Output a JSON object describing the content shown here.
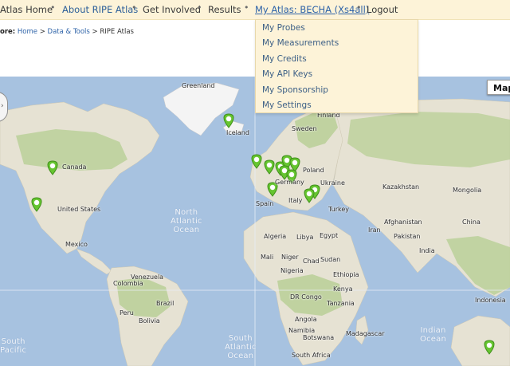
{
  "nav": {
    "items": [
      {
        "label": "Atlas Home"
      },
      {
        "label": "About RIPE Atlas"
      },
      {
        "label": "Get Involved"
      },
      {
        "label": "Results"
      },
      {
        "label": "My Atlas: BECHA (Xs4all)"
      },
      {
        "label": "Logout"
      }
    ],
    "separator": "•",
    "colors": {
      "bar": "#fdf3d8",
      "link": "#2e63a8"
    }
  },
  "breadcrumb": {
    "prefix": "ore:",
    "items": [
      "Home",
      "Data & Tools"
    ],
    "sep": ">",
    "current": "RIPE Atlas"
  },
  "dropdown": {
    "items": [
      "My Probes",
      "My Measurements",
      "My Credits",
      "My API Keys",
      "My Sponsorship",
      "My Settings"
    ]
  },
  "map": {
    "type_button": "Map",
    "countries": [
      "Greenland",
      "Iceland",
      "Sweden",
      "Finland",
      "Canada",
      "United States",
      "Mexico",
      "Germany",
      "Poland",
      "Ukraine",
      "Kazakhstan",
      "Mongolia",
      "Spain",
      "Italy",
      "Turkey",
      "Iran",
      "Afghanistan",
      "Algeria",
      "Libya",
      "Egypt",
      "Mali",
      "Niger",
      "Chad",
      "Sudan",
      "Nigeria",
      "Ethiopia",
      "Kenya",
      "Tanzania",
      "DR Congo",
      "Angola",
      "Namibia",
      "Botswana",
      "Madagascar",
      "South Africa",
      "Venezuela",
      "Colombia",
      "Peru",
      "Brazil",
      "Bolivia",
      "India",
      "Pakistan",
      "China",
      "Indonesia"
    ],
    "oceans": [
      {
        "line1": "North",
        "line2": "Atlantic",
        "line3": "Ocean"
      },
      {
        "line1": "South",
        "line2": "Atlantic",
        "line3": "Ocean"
      },
      {
        "line1": "Indian",
        "line2": "Ocean"
      },
      {
        "line1": "South",
        "line2": "Pacific"
      }
    ],
    "colors": {
      "water": "#a7c2e0",
      "land": "#e6e2d3",
      "forest": "#b8cf96",
      "ice": "#f4f4f4",
      "marker": "#66c530"
    }
  }
}
